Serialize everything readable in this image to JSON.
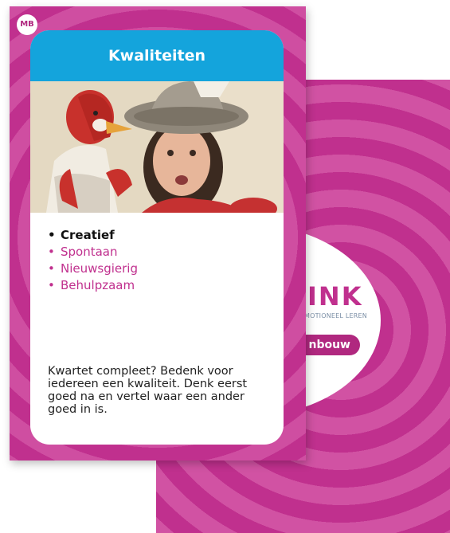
{
  "colors": {
    "card_magenta": "#c0308e",
    "title_blue": "#14a4dc",
    "trait_highlight": "#111111",
    "trait_other": "#c0308e"
  },
  "back_card": {
    "logo_text": "INK",
    "tagline": "MOTIONEEL LEREN",
    "pill_label": "nbouw"
  },
  "front_card": {
    "badge": "MB",
    "title": "Kwaliteiten",
    "photo_icon": "girl-with-hat-and-hand-puppet",
    "traits": [
      {
        "bullet": "•",
        "label": "Creatief"
      },
      {
        "bullet": "•",
        "label": "Spontaan"
      },
      {
        "bullet": "•",
        "label": "Nieuwsgierig"
      },
      {
        "bullet": "•",
        "label": "Behulpzaam"
      }
    ],
    "instruction": "Kwartet compleet? Bedenk voor iedereen een kwaliteit. Denk eerst goed na en vertel waar een ander goed in is."
  }
}
